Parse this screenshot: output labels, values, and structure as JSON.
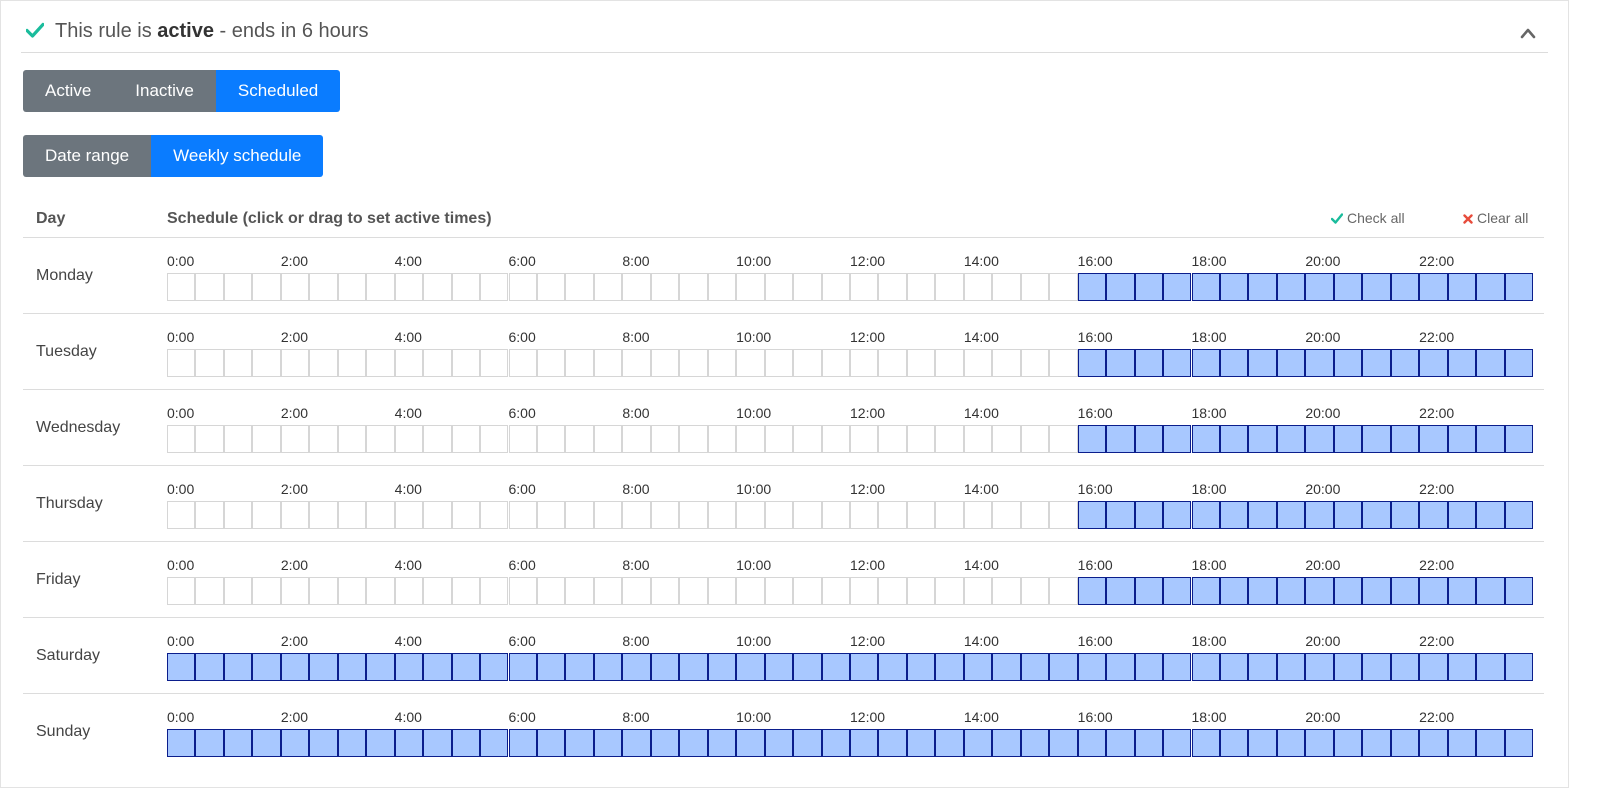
{
  "header": {
    "prefix": "This rule is",
    "status_word": "active",
    "suffix": "- ends in 6 hours",
    "accent_color": "#1abc9c"
  },
  "mode_buttons": [
    {
      "label": "Active",
      "selected": false
    },
    {
      "label": "Inactive",
      "selected": false
    },
    {
      "label": "Scheduled",
      "selected": true
    }
  ],
  "schedule_type_buttons": [
    {
      "label": "Date range",
      "selected": false
    },
    {
      "label": "Weekly schedule",
      "selected": true
    }
  ],
  "table": {
    "day_header": "Day",
    "schedule_header": "Schedule (click or drag to set active times)",
    "check_all": "Check all",
    "clear_all": "Clear all",
    "tick_labels": [
      "0:00",
      "2:00",
      "4:00",
      "6:00",
      "8:00",
      "10:00",
      "12:00",
      "14:00",
      "16:00",
      "18:00",
      "20:00",
      "22:00"
    ],
    "slots_per_day": 48,
    "active_color": "#a8c8ff",
    "days": [
      {
        "name": "Monday",
        "active_from_slot": 32
      },
      {
        "name": "Tuesday",
        "active_from_slot": 32
      },
      {
        "name": "Wednesday",
        "active_from_slot": 32
      },
      {
        "name": "Thursday",
        "active_from_slot": 32
      },
      {
        "name": "Friday",
        "active_from_slot": 32
      },
      {
        "name": "Saturday",
        "active_from_slot": 0
      },
      {
        "name": "Sunday",
        "active_from_slot": 0
      }
    ]
  }
}
